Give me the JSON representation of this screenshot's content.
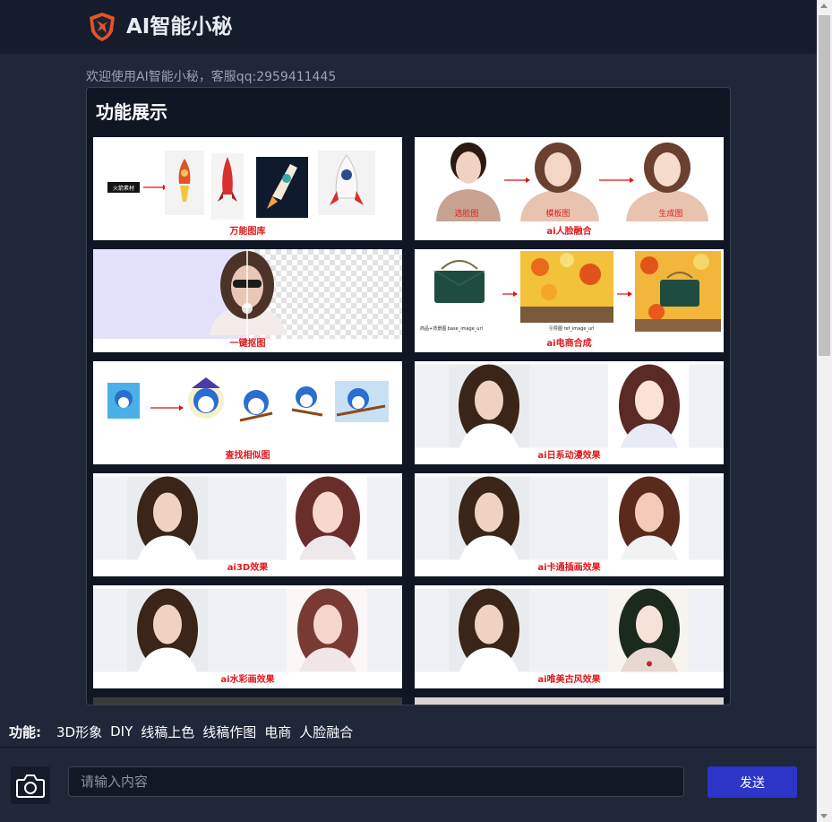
{
  "header": {
    "title": "AI智能小秘"
  },
  "welcome": "欢迎使用AI智能小秘，客服qq:2959411445",
  "showcase": {
    "title": "功能展示",
    "cards": [
      {
        "label": "万能图库",
        "tag": "火箭素材"
      },
      {
        "label": "ai人脸融合",
        "tags": [
          "选脸图",
          "模板图",
          "生成图"
        ]
      },
      {
        "label": "一键抠图"
      },
      {
        "label": "ai电商合成",
        "captions": [
          "商品+背景图 base_image_url",
          "引导图 ref_image_url"
        ]
      },
      {
        "label": "查找相似图"
      },
      {
        "label": "ai日系动漫效果"
      },
      {
        "label": "ai3D效果"
      },
      {
        "label": "ai卡通插画效果"
      },
      {
        "label": "ai水彩画效果"
      },
      {
        "label": "ai唯美古风效果"
      }
    ]
  },
  "functions": {
    "label": "功能:",
    "items": [
      "3D形象",
      "DIY",
      "线稿上色",
      "线稿作图",
      "电商",
      "人脸融合"
    ]
  },
  "composer": {
    "placeholder": "请输入内容",
    "send_label": "发送"
  },
  "colors": {
    "header_bg": "#151c2b",
    "page_bg": "#1f2738",
    "accent": "#2d35c8",
    "label_red": "#e1161a",
    "logo": "#e0542a"
  },
  "icons": {
    "logo": "fox-shield-logo",
    "camera": "camera-icon"
  }
}
